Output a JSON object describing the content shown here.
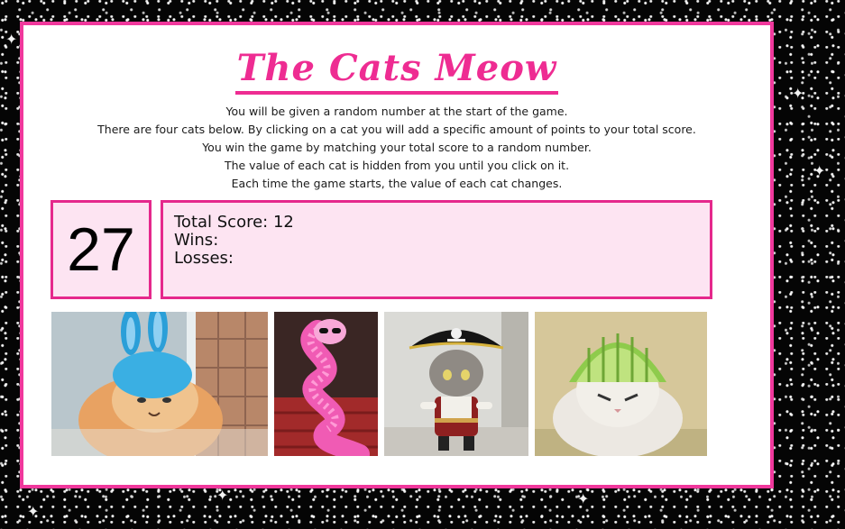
{
  "game": {
    "title": "The Cats Meow",
    "instructions": [
      "You will be given a random number at the start of the game.",
      "There are four cats below. By clicking on a cat you will add a specific amount of points to your total score.",
      "You win the game by matching your total score to a random number.",
      "The value of each cat is hidden from you until you click on it.",
      "Each time the game starts, the value of each cat changes."
    ],
    "target_number": "27",
    "total_score_text": "Total Score: 12",
    "wins_text": "Wins:",
    "losses_text": "Losses:"
  },
  "cats": [
    {
      "name": "bunny-hat-cat",
      "subject": "persian cat in blue bunny-ear hat"
    },
    {
      "name": "pink-feather-boa-cat",
      "subject": "cat in pink feather boa and sunglasses"
    },
    {
      "name": "pirate-costume-cat",
      "subject": "cat in pirate costume"
    },
    {
      "name": "lime-helmet-cat",
      "subject": "cat wearing lime rind helmet"
    }
  ],
  "colors": {
    "accent": "#ee2c92",
    "box_background": "#fde4f2",
    "page_background": "#050505"
  }
}
